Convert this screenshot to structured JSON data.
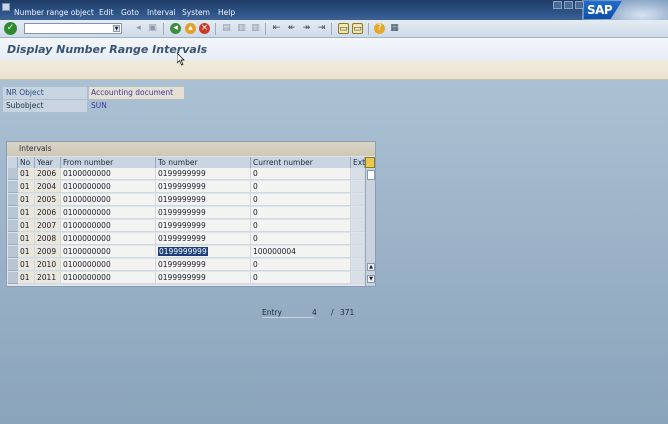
{
  "menubar": {
    "items": [
      "Number range object",
      "Edit",
      "Goto",
      "Interval",
      "System",
      "Help"
    ],
    "logo": "SAP"
  },
  "title": "Display Number Range Intervals",
  "fields": {
    "nr_object_label": "NR Object",
    "nr_object_value": "Accounting document",
    "subobject_label": "Subobject",
    "subobject_value": "SUN"
  },
  "intervals": {
    "title": "Intervals",
    "headers": [
      "No",
      "Year",
      "From number",
      "To number",
      "Current number",
      "Ext"
    ],
    "rows": [
      [
        "01",
        "2006",
        "0100000000",
        "0199999999",
        "0"
      ],
      [
        "01",
        "2004",
        "0100000000",
        "0199999999",
        "0"
      ],
      [
        "01",
        "2005",
        "0100000000",
        "0199999999",
        "0"
      ],
      [
        "01",
        "2006",
        "0100000000",
        "0199999999",
        "0"
      ],
      [
        "01",
        "2007",
        "0100000000",
        "0199999999",
        "0"
      ],
      [
        "01",
        "2008",
        "0100000000",
        "0199999999",
        "0"
      ],
      [
        "01",
        "2009",
        "0100000000",
        "0199999999",
        "100000004"
      ],
      [
        "01",
        "2010",
        "0100000000",
        "0199999999",
        "0"
      ],
      [
        "01",
        "2011",
        "0100000000",
        "0199999999",
        "0"
      ]
    ]
  },
  "entry": {
    "label": "Entry",
    "current": "4",
    "separator": "/",
    "total": "371"
  }
}
